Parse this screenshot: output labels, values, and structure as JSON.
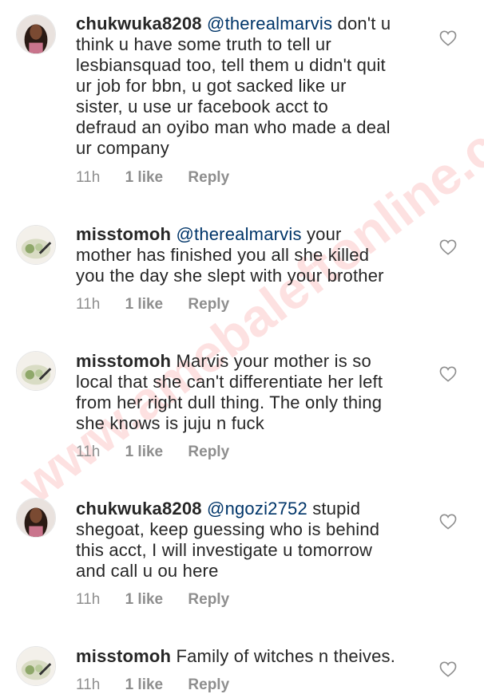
{
  "comments": [
    {
      "username": "chukwuka8208",
      "mention": "@therealmarvis",
      "lines": [
        "don't u",
        "think u have some truth to tell ur",
        "lesbiansquad too,  tell them u didn't quit",
        "ur job for bbn,  u got sacked like ur",
        "sister,  u use ur facebook acct to",
        "defraud an oyibo man who made a deal",
        "ur company"
      ],
      "time": "11h",
      "likes": "1 like",
      "reply": "Reply"
    },
    {
      "username": "misstomoh",
      "mention": "@therealmarvis",
      "lines": [
        "your",
        "mother has finished you all she killed",
        "you the day she slept with your brother"
      ],
      "time": "11h",
      "likes": "1 like",
      "reply": "Reply"
    },
    {
      "username": "misstomoh",
      "mention": "",
      "lines": [
        "Marvis your mother is so",
        "local that she can't differentiate her left",
        "from her right dull thing. The only thing",
        "she knows is juju n fuck"
      ],
      "time": "11h",
      "likes": "1 like",
      "reply": "Reply"
    },
    {
      "username": "chukwuka8208",
      "mention": "@ngozi2752",
      "lines": [
        "stupid",
        "shegoat, keep guessing who is behind",
        "this acct,  I will investigate u tomorrow",
        "and call u ou here"
      ],
      "time": "11h",
      "likes": "1 like",
      "reply": "Reply"
    },
    {
      "username": "misstomoh",
      "mention": "",
      "lines": [
        "Family of witches n theives."
      ],
      "time": "11h",
      "likes": "1 like",
      "reply": "Reply"
    }
  ],
  "watermark": "www.amebaleftonline.com",
  "icons": {
    "like": "heart-outline-icon"
  },
  "colors": {
    "text": "#262626",
    "mention": "#003569",
    "meta": "#8e8e8e"
  }
}
